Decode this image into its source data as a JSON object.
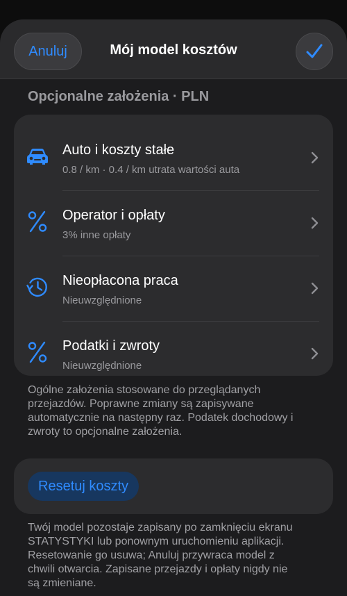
{
  "header": {
    "cancel_label": "Anuluj",
    "title": "Mój model kosztów",
    "confirm_icon": "checkmark-icon"
  },
  "section": {
    "title": "Opcjonalne założenia · PLN"
  },
  "items": [
    {
      "title": "Auto i koszty stałe",
      "subtitle": "0.8 / km · 0.4 / km utrata wartości auta",
      "icon": "car-icon"
    },
    {
      "title": "Operator i opłaty",
      "subtitle": "3% inne opłaty",
      "icon": "percent-icon"
    },
    {
      "title": "Nieopłacona praca",
      "subtitle": "Nieuwzględnione",
      "icon": "history-clock-icon"
    },
    {
      "title": "Podatki i zwroty",
      "subtitle": "Nieuwzględnione",
      "icon": "percent-icon"
    }
  ],
  "note1": {
    "lines": [
      "Ogólne założenia stosowane do przeglądanych",
      "przejazdów. Poprawne zmiany są zapisywane",
      "automatycznie na następny raz. Podatek dochodowy i",
      "zwroty to opcjonalne założenia."
    ]
  },
  "reset": {
    "label": "Resetuj koszty"
  },
  "note2": {
    "lines": [
      "Twój model pozostaje zapisany po zamknięciu ekranu",
      "STATYSTYKI lub ponownym uruchomieniu aplikacji.",
      "Resetowanie go usuwa; Anuluj przywraca model z",
      "chwili otwarcia. Zapisane przejazdy i opłaty nigdy nie",
      "są zmieniane."
    ]
  },
  "colors": {
    "accent": "#2f8bff",
    "background": "#1c1c1e",
    "card": "#2c2c2e",
    "secondary_text": "#9a9a9e"
  }
}
